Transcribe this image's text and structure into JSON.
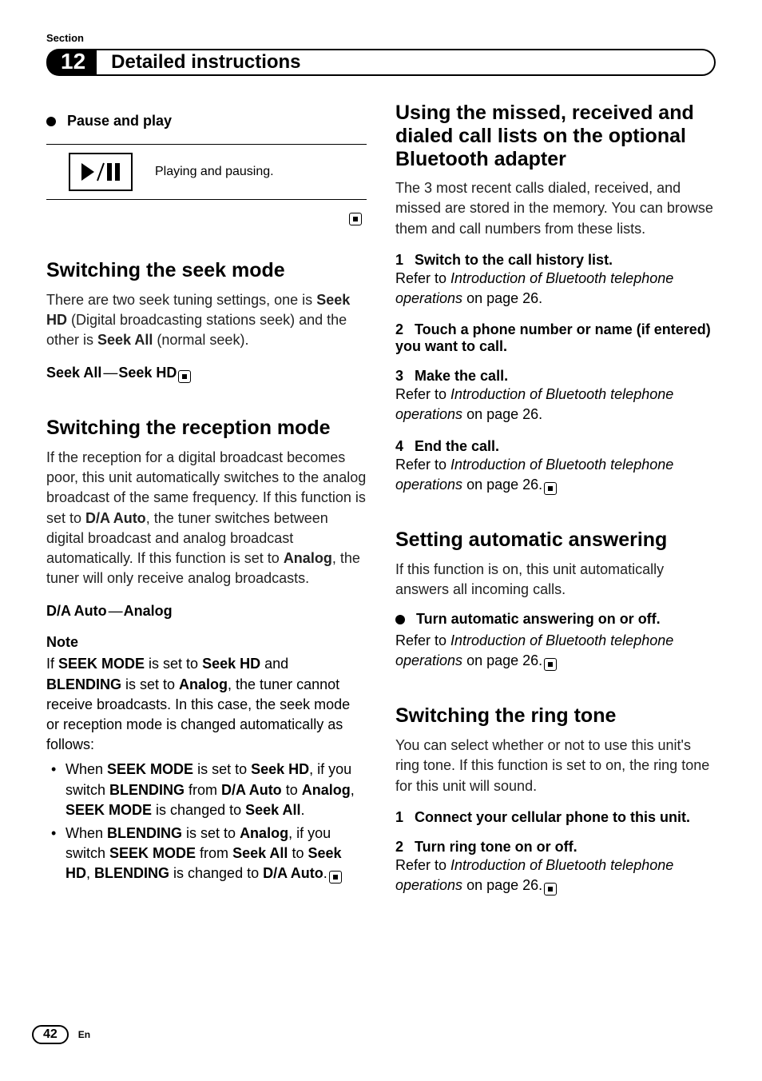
{
  "header": {
    "section_label": "Section",
    "section_number": "12",
    "title": "Detailed instructions"
  },
  "left": {
    "pause_play_label": "Pause and play",
    "pause_play_desc": "Playing and pausing.",
    "seek": {
      "heading": "Switching the seek mode",
      "body_pre": "There are two seek tuning settings, one is ",
      "seek_hd": "Seek HD",
      "body_mid": " (Digital broadcasting stations seek) and the other is ",
      "seek_all": "Seek All",
      "body_post": " (normal seek).",
      "options_a": "Seek All",
      "options_b": "Seek HD"
    },
    "reception": {
      "heading": "Switching the reception mode",
      "p1a": "If the reception for a digital broadcast becomes poor, this unit automatically switches to the analog broadcast of the same frequency. If this function is set to ",
      "da_auto": "D/A Auto",
      "p1b": ", the tuner switches between digital broadcast and analog broadcast automatically. If this function is set to ",
      "analog": "Analog",
      "p1c": ", the tuner will only receive analog broadcasts.",
      "opts_a": "D/A Auto",
      "opts_b": "Analog",
      "note_head": "Note",
      "note_p_a": "If ",
      "seek_mode": "SEEK MODE",
      "note_p_b": " is set to ",
      "seek_hd": "Seek HD",
      "note_p_c": " and ",
      "blending": "BLENDING",
      "note_p_d": " is set to ",
      "analog2": "Analog",
      "note_p_e": ", the tuner cannot receive broadcasts. In this case, the seek mode or reception mode is changed automatically as follows:",
      "li1_a": "When ",
      "li1_b": " is set to ",
      "li1_c": ", if you switch ",
      "li1_d": " from ",
      "li1_e": " to ",
      "li1_f": " is changed to ",
      "seek_all": "Seek All",
      "li2_a": "When ",
      "li2_b": " is set to ",
      "li2_c": ", if you switch ",
      "li2_d": " from ",
      "li2_e": " to ",
      "li2_f": " is changed to "
    }
  },
  "right": {
    "call_lists": {
      "heading": "Using the missed, received and dialed call lists on the optional Bluetooth adapter",
      "intro": "The 3 most recent calls dialed, received, and missed are stored in the memory. You can browse them and call numbers from these lists.",
      "s1_head": "Switch to the call history list.",
      "ref_pre": "Refer to ",
      "ref_title": "Introduction of Bluetooth telephone operations",
      "ref_post": " on page 26.",
      "s2_head": "Touch a phone number or name (if entered) you want to call.",
      "s3_head": "Make the call.",
      "s4_head": "End the call."
    },
    "auto_answer": {
      "heading": "Setting automatic answering",
      "intro": "If this function is on, this unit automatically answers all incoming calls.",
      "bullet": "Turn automatic answering on or off."
    },
    "ring_tone": {
      "heading": "Switching the ring tone",
      "intro": "You can select whether or not to use this unit's ring tone. If this function is set to on, the ring tone for this unit will sound.",
      "s1_head": "Connect your cellular phone to this unit.",
      "s2_head": "Turn ring tone on or off."
    }
  },
  "footer": {
    "page": "42",
    "lang": "En"
  }
}
